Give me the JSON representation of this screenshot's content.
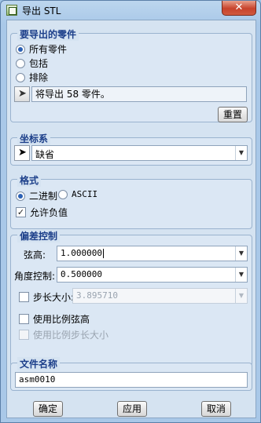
{
  "window": {
    "title": "导出 STL",
    "close_glyph": "✕"
  },
  "parts_group": {
    "title": "要导出的零件",
    "options": [
      {
        "label": "所有零件",
        "checked": true
      },
      {
        "label": "包括",
        "checked": false
      },
      {
        "label": "排除",
        "checked": false
      }
    ],
    "status_text": "将导出 58 零件。",
    "reset_label": "重置"
  },
  "coord_group": {
    "title": "坐标系",
    "selected": "缺省"
  },
  "format_group": {
    "title": "格式",
    "binary_label": "二进制",
    "ascii_label": "ASCII",
    "format_selected": "二进制",
    "allow_negative_label": "允许负值",
    "allow_negative_checked": true
  },
  "deviation_group": {
    "title": "偏差控制",
    "chord_height_label": "弦高:",
    "chord_height_value": "1.000000",
    "angle_control_label": "角度控制:",
    "angle_control_value": "0.500000",
    "step_size_label": "步长大小:",
    "step_size_value": "3.895710",
    "step_size_checked": false,
    "ratio_chord_label": "使用比例弦高",
    "ratio_chord_checked": false,
    "ratio_step_label": "使用比例步长大小",
    "ratio_step_checked": false
  },
  "filename_group": {
    "title": "文件名称",
    "value": "asm0010"
  },
  "footer": {
    "ok_label": "确定",
    "apply_label": "应用",
    "cancel_label": "取消"
  },
  "colors": {
    "group_title": "#1c3f8a",
    "client_bg": "#d5e3f1",
    "close_button": "#c7432c"
  }
}
